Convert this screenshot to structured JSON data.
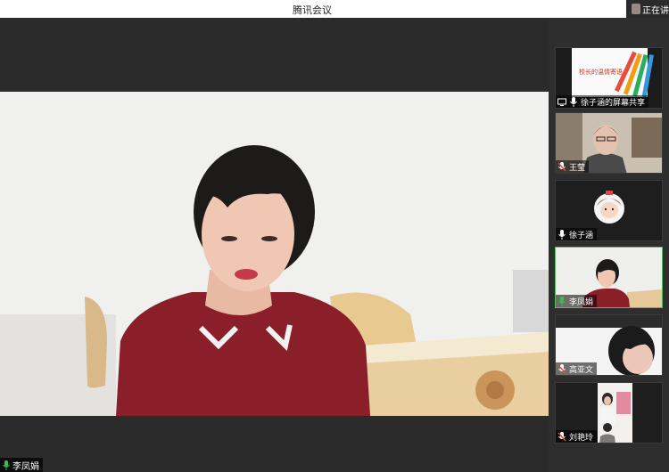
{
  "window": {
    "title": "腾讯会议",
    "recording_text": "正在讲"
  },
  "main_speaker": {
    "name": "李凤娟",
    "mic_color": "#3dbb4d"
  },
  "participants": [
    {
      "name": "徐子涵的屏幕共享",
      "type": "screen-share",
      "slide_title": "校长的温情寄语",
      "mic": "white"
    },
    {
      "name": "王莹",
      "type": "video",
      "mic": "muted"
    },
    {
      "name": "徐子涵",
      "type": "avatar",
      "mic": "white"
    },
    {
      "name": "李凤娟",
      "type": "video",
      "mic": "green",
      "active": true
    },
    {
      "name": "高亚文",
      "type": "video",
      "mic": "muted"
    },
    {
      "name": "刘艳玲",
      "type": "video",
      "mic": "muted"
    }
  ],
  "colors": {
    "active_border": "#4fbf5a",
    "mic_green": "#3dbb4d",
    "mic_muted": "#e04848",
    "mic_white": "#ffffff"
  }
}
